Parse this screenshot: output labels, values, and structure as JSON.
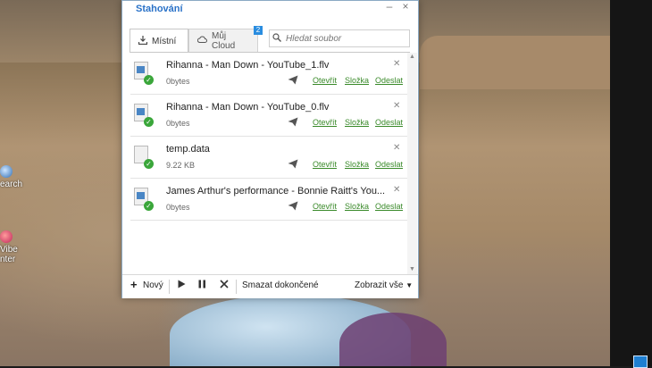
{
  "window": {
    "title": "Stahování",
    "minimize_glyph": "–",
    "close_glyph": "×"
  },
  "tabs": [
    {
      "label": "Místní",
      "icon": "download-tray-icon",
      "active": true
    },
    {
      "label": "Můj Cloud",
      "icon": "cloud-icon",
      "active": false,
      "badge": "2"
    }
  ],
  "search": {
    "placeholder": "Hledat soubor"
  },
  "downloads": [
    {
      "name": "Rihanna - Man Down - YouTube_1.flv",
      "size": "0bytes",
      "type": "video"
    },
    {
      "name": "Rihanna - Man Down - YouTube_0.flv",
      "size": "0bytes",
      "type": "video"
    },
    {
      "name": "temp.data",
      "size": "9.22 KB",
      "type": "blank"
    },
    {
      "name": "James Arthur's performance - Bonnie Raitt's You...",
      "size": "0bytes",
      "type": "video"
    }
  ],
  "actions": {
    "open": "Otevřít",
    "folder": "Složka",
    "send": "Odeslat"
  },
  "bottom": {
    "new_label": "Nový",
    "clear_label": "Smazat dokončené",
    "show_label": "Zobrazit vše"
  },
  "desktop_icons": [
    {
      "label": "earch",
      "icon": "search-icon"
    },
    {
      "label": "Vibe",
      "label2": "nter",
      "icon": "vibe-icon"
    }
  ],
  "colors": {
    "accent": "#2a72c8",
    "link": "#3a8a2a",
    "check": "#3aa63a",
    "badge": "#2a8de0"
  }
}
